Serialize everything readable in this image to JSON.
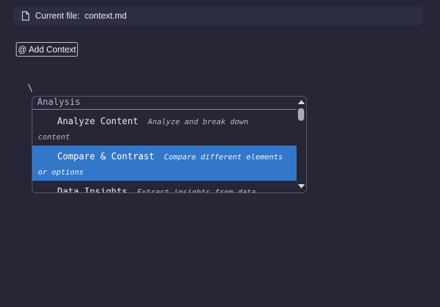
{
  "file_bar": {
    "label": "Current file:",
    "filename": "context.md",
    "icon": "file-icon"
  },
  "add_context": {
    "label": "@ Add Context"
  },
  "editor": {
    "text": "\\"
  },
  "menu": {
    "header": "Analysis",
    "items": [
      {
        "title": "Analyze Content",
        "desc_line1": "Analyze and break down",
        "desc_line2": "content",
        "selected": false
      },
      {
        "title": "Compare & Contrast",
        "desc_line1": "Compare different elements",
        "desc_line2": "or options",
        "selected": true
      },
      {
        "title": "Data Insights",
        "desc_line1": "Extract insights from data",
        "desc_line2": "",
        "selected": false
      }
    ]
  },
  "colors": {
    "background": "#262637",
    "file_bar": "#2e2e42",
    "selection": "#3377c9"
  }
}
